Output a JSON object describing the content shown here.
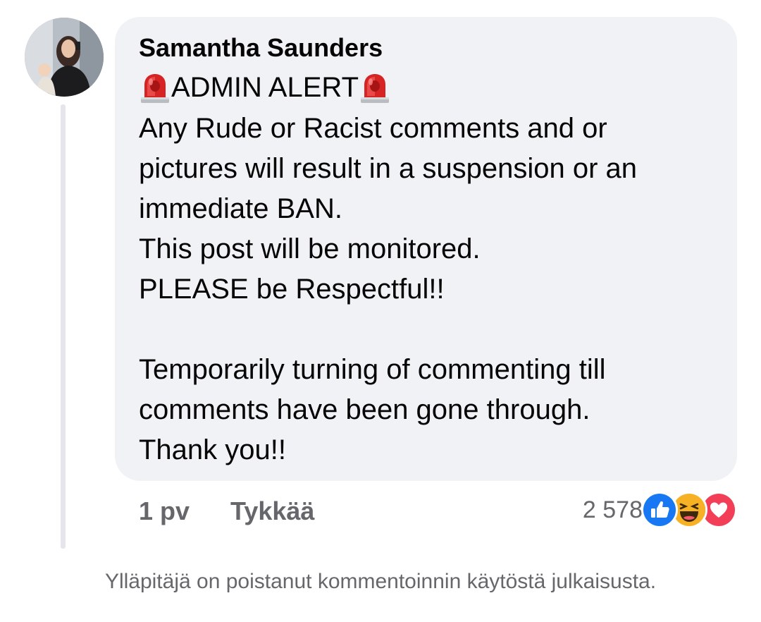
{
  "comment": {
    "author": "Samantha Saunders",
    "alert_title": "ADMIN ALERT",
    "lines": [
      "Any Rude or Racist comments and or",
      "pictures will result in a suspension or an",
      "immediate BAN.",
      "This post will be monitored.",
      "PLEASE be Respectful!!",
      "Temporarily turning of commenting till",
      "comments have been gone through.",
      "Thank you!!"
    ],
    "timestamp": "1 pv",
    "like_label": "Tykkää",
    "reaction_count": "2 578",
    "reaction_icons": [
      "like-icon",
      "haha-icon",
      "love-icon"
    ],
    "alert_icon": "police-siren-icon"
  },
  "footer": {
    "notice": "Ylläpitäjä on poistanut kommentoinnin käytöstä julkaisusta."
  },
  "colors": {
    "bubble": "#f0f2f5",
    "meta_text": "#65676b",
    "like_blue": "#1877f2",
    "love_red": "#f33e58",
    "haha_yellow": "#f7b125"
  }
}
